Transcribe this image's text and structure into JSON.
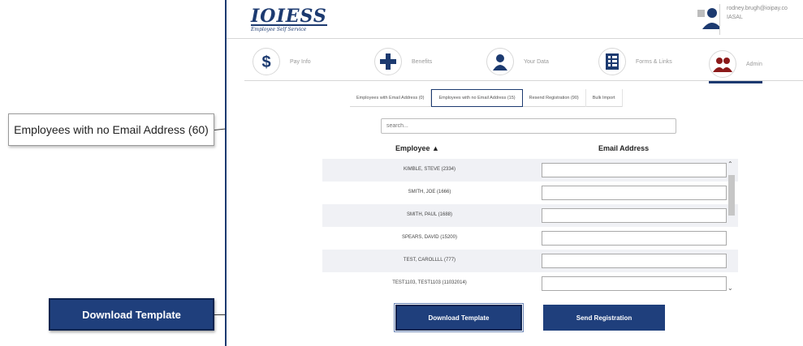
{
  "callouts": {
    "email_label": "Employees with no Email Address (60)",
    "download_label": "Download Template"
  },
  "header": {
    "logo": "IOIESS",
    "logo_sub": "Employee Self Service",
    "user_email": "rodney.brugh@ioipay.co",
    "user_sub": "IASAL"
  },
  "nav": {
    "tabs": [
      {
        "label": "Pay Info",
        "icon": "dollar-icon"
      },
      {
        "label": "Benefits",
        "icon": "plus-icon"
      },
      {
        "label": "Your Data",
        "icon": "person-icon"
      },
      {
        "label": "Forms & Links",
        "icon": "list-icon"
      },
      {
        "label": "Admin",
        "icon": "people-icon"
      }
    ]
  },
  "subtabs": [
    "Employees with Email Address (0)",
    "Employees with no Email Address (15)",
    "Resend Registration (90)",
    "Bulk Import"
  ],
  "search": {
    "placeholder": "search..."
  },
  "table": {
    "col_employee": "Employee ▲",
    "col_email": "Email Address",
    "rows": [
      "KIMBLE, STEVE (2334)",
      "SMITH, JOE (1666)",
      "SMITH, PAUL (1688)",
      "SPEARS, DAVID (15200)",
      "TEST, CAROLLLL (777)",
      "TEST1103, TEST1103 (11032014)"
    ]
  },
  "buttons": {
    "download": "Download Template",
    "send": "Send Registration"
  },
  "colors": {
    "brand": "#1c3a70",
    "button": "#1f3f7c",
    "admin_accent": "#8b1a1a"
  }
}
